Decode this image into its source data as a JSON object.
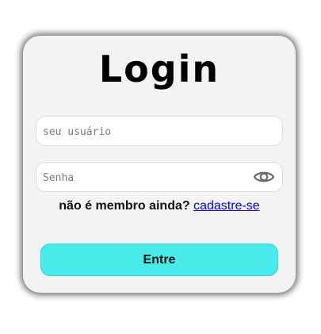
{
  "login_card": {
    "title": "Login",
    "username": {
      "placeholder": "seu usuário",
      "value": ""
    },
    "password": {
      "placeholder": "Senha",
      "value": "",
      "toggle_icon": "eye-icon"
    },
    "signup": {
      "prompt": "não é membro ainda?",
      "link_label": "cadastre-se"
    },
    "submit_label": "Entre"
  },
  "colors": {
    "card_background": "#f3f3f3",
    "button_background": "#48eaea",
    "link": "#0000ee"
  }
}
